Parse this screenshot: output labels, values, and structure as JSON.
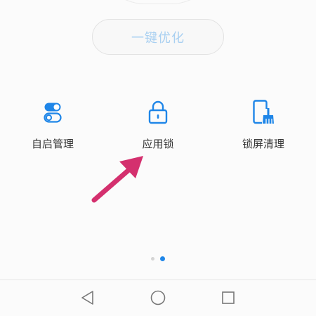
{
  "optimize": {
    "label": "一键优化"
  },
  "tools": [
    {
      "label": "自启管理",
      "icon": "toggle-switch-icon"
    },
    {
      "label": "应用锁",
      "icon": "lock-icon"
    },
    {
      "label": "锁屏清理",
      "icon": "phone-broom-icon"
    }
  ],
  "pager": {
    "pages": 2,
    "active": 2
  },
  "nav": {
    "back": "back-triangle-icon",
    "home": "home-circle-icon",
    "recents": "recents-square-icon"
  },
  "colors": {
    "accent": "#1f86e8",
    "arrow": "#d4306e",
    "optimize_text": "#a9d0f1"
  }
}
